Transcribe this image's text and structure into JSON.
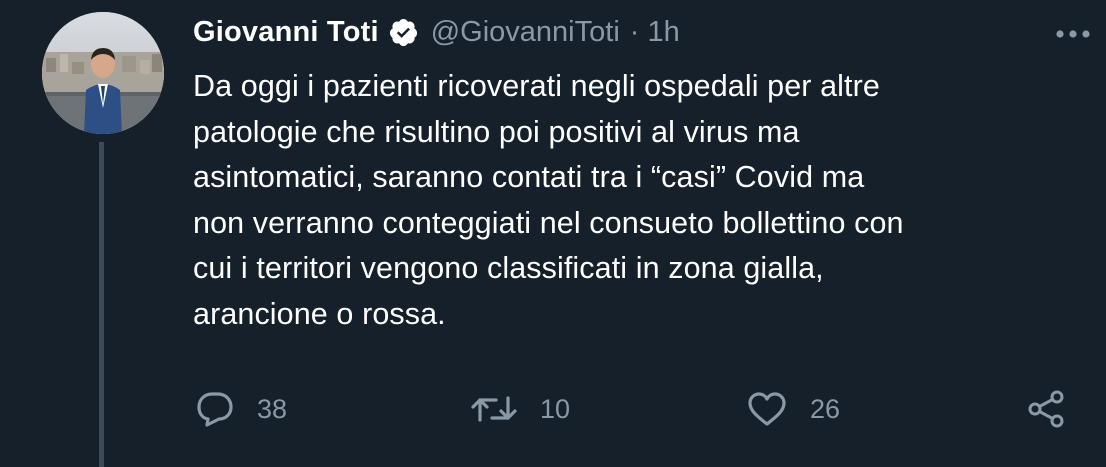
{
  "tweet": {
    "author": {
      "display_name": "Giovanni Toti",
      "handle": "@GiovanniToti",
      "verified": true,
      "avatar_icon": "profile-photo"
    },
    "separator": "·",
    "timestamp": "1h",
    "more_icon": "more-horizontal-icon",
    "text_lines": [
      "Da oggi i pazienti ricoverati negli ospedali per altre",
      "patologie che risultino poi positivi al virus ma",
      "asintomatici, saranno contati tra i “casi” Covid ma",
      "non verranno conteggiati nel consueto bollettino con",
      "cui i territori vengono classificati in zona gialla,",
      "arancione o rossa."
    ],
    "actions": {
      "reply": {
        "icon": "reply-icon",
        "count": "38"
      },
      "retweet": {
        "icon": "retweet-icon",
        "count": "10"
      },
      "like": {
        "icon": "heart-icon",
        "count": "26"
      },
      "share": {
        "icon": "share-icon"
      }
    }
  },
  "colors": {
    "background": "#15202b",
    "primary_text": "#ffffff",
    "secondary_text": "#8b98a5",
    "thread_line": "#3d4a57",
    "verified_badge": "#ffffff"
  }
}
